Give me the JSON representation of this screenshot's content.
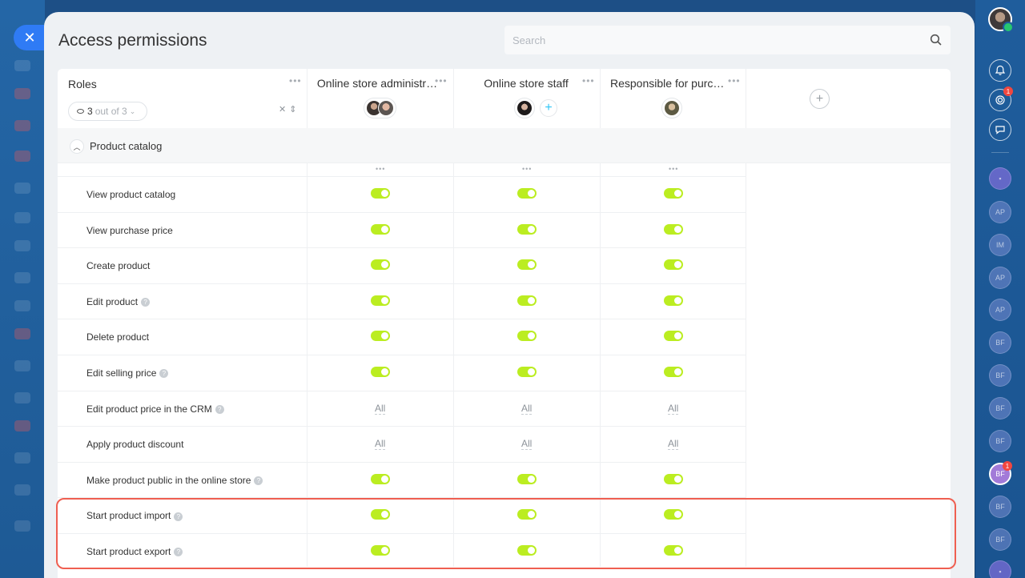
{
  "page": {
    "title": "Access permissions",
    "search_placeholder": "Search"
  },
  "table": {
    "roles_header": "Roles",
    "visible_count": "3",
    "visible_total": "out of 3",
    "columns": [
      {
        "title": "Online store administr…",
        "members": 2
      },
      {
        "title": "Online store staff",
        "members": 1
      },
      {
        "title": "Responsible for purch…",
        "members": 1
      }
    ],
    "section": {
      "label": "Product catalog"
    },
    "rows": [
      {
        "label": "View product catalog",
        "help": false,
        "values": [
          "on",
          "on",
          "on"
        ]
      },
      {
        "label": "View purchase price",
        "help": false,
        "values": [
          "on",
          "on",
          "on"
        ]
      },
      {
        "label": "Create product",
        "help": false,
        "values": [
          "on",
          "on",
          "on"
        ]
      },
      {
        "label": "Edit product",
        "help": true,
        "values": [
          "on",
          "on",
          "on"
        ]
      },
      {
        "label": "Delete product",
        "help": false,
        "values": [
          "on",
          "on",
          "on"
        ]
      },
      {
        "label": "Edit selling price",
        "help": true,
        "values": [
          "on",
          "on",
          "on"
        ]
      },
      {
        "label": "Edit product price in the CRM",
        "help": true,
        "values": [
          "All",
          "All",
          "All"
        ]
      },
      {
        "label": "Apply product discount",
        "help": false,
        "values": [
          "All",
          "All",
          "All"
        ]
      },
      {
        "label": "Make product public in the online store",
        "help": true,
        "values": [
          "on",
          "on",
          "on"
        ]
      },
      {
        "label": "Start product import",
        "help": true,
        "values": [
          "on",
          "on",
          "on"
        ]
      },
      {
        "label": "Start product export",
        "help": true,
        "values": [
          "on",
          "on",
          "on"
        ]
      }
    ]
  },
  "rail": {
    "badges": [
      "1",
      "1"
    ],
    "chat_initials": [
      "AP",
      "IM",
      "AP",
      "AP",
      "BF",
      "BF",
      "BF",
      "BF",
      "BF",
      "BF",
      "BF"
    ]
  },
  "colors": {
    "toggle_on": "#bbed21",
    "highlight": "#ef5f51",
    "close_button": "#2f7bf5"
  }
}
